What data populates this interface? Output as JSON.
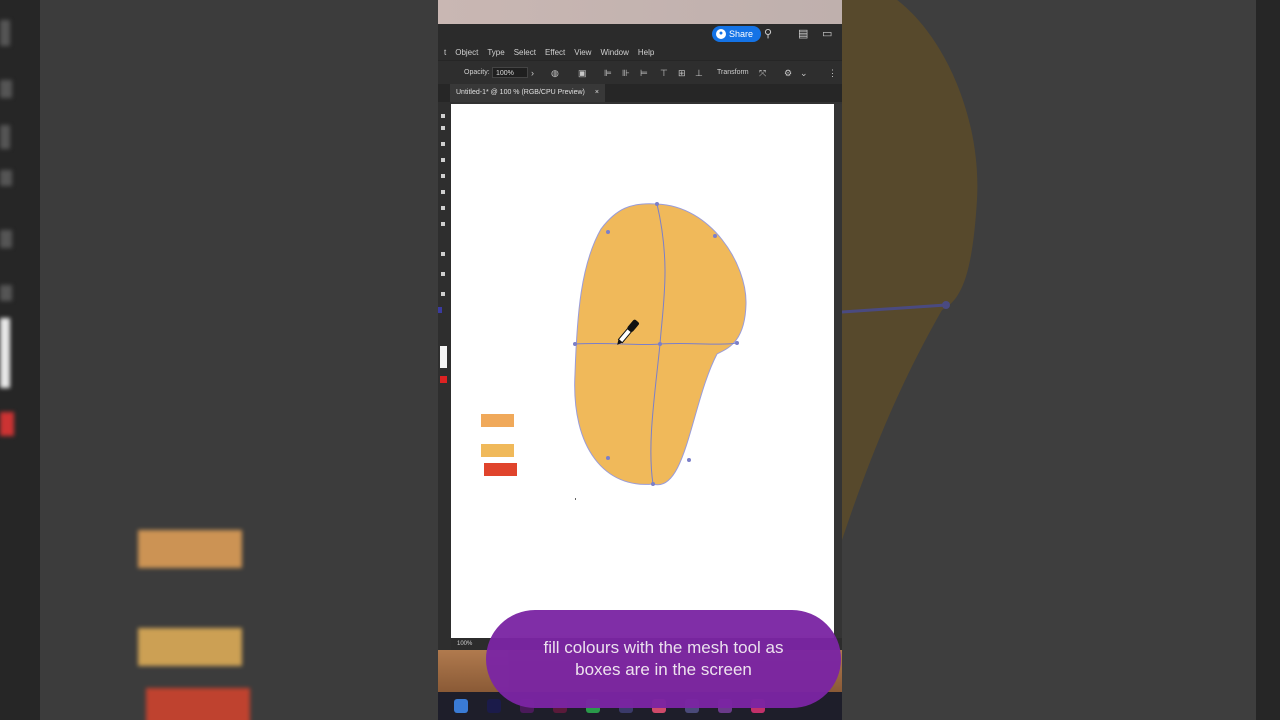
{
  "app": {
    "share_label": "Share",
    "menu": [
      "t",
      "Object",
      "Type",
      "Select",
      "Effect",
      "View",
      "Window",
      "Help"
    ],
    "control": {
      "opacity_label": "Opacity:",
      "opacity_value": "100%",
      "transform_label": "Transform"
    },
    "document_tab": {
      "title": "Untitled-1* @ 100 % (RGB/CPU Preview)",
      "close": "×"
    },
    "status_zoom": "100%"
  },
  "canvas": {
    "shape_fill": "#f0b95a",
    "mesh_line_color": "#7b7fc9",
    "swatches": [
      "#f0a95a",
      "#f0b95a",
      "#e0442c"
    ]
  },
  "caption": {
    "text": "fill colours with the mesh tool as boxes are in the screen",
    "bg": "#7b25a3"
  }
}
